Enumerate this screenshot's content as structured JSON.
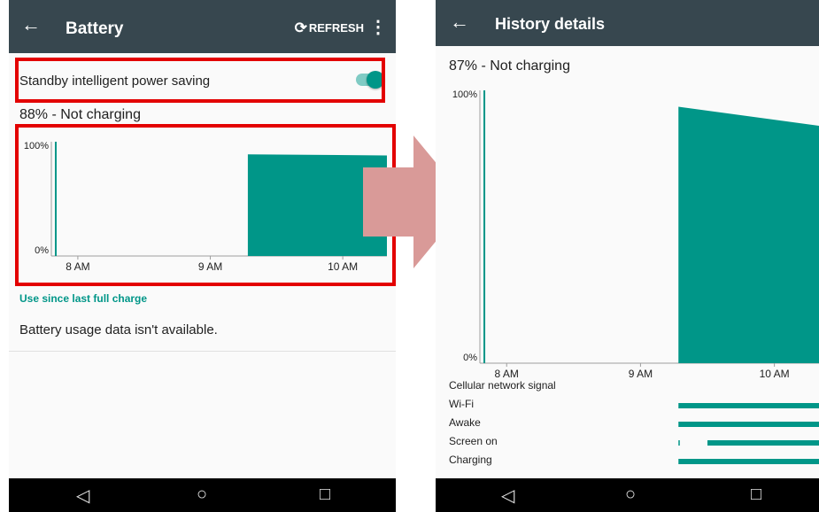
{
  "left": {
    "appbar": {
      "title": "Battery",
      "refresh_label": "REFRESH"
    },
    "standby_saving": {
      "label": "Standby intelligent power saving",
      "enabled": true
    },
    "status": "88% - Not charging",
    "chart_data": {
      "type": "area",
      "title": "",
      "x_ticks": [
        "8 AM",
        "9 AM",
        "10 AM"
      ],
      "y_ticks": [
        "0%",
        "100%"
      ],
      "ylim": [
        0,
        100
      ],
      "x_range": [
        "7:48 AM",
        "10:20 AM"
      ],
      "series": [
        {
          "x": [
            "7:50 AM",
            "7:50 AM"
          ],
          "y": [
            100,
            0
          ]
        },
        {
          "x": [
            "9:17 AM",
            "10:20 AM"
          ],
          "y": [
            89,
            88
          ]
        }
      ]
    },
    "usage_link": "Use since last full charge",
    "usage_message": "Battery usage data isn't available."
  },
  "right": {
    "appbar": {
      "title": "History details"
    },
    "status": "87% - Not charging",
    "chart_data": {
      "type": "area",
      "title": "",
      "x_ticks": [
        "8 AM",
        "9 AM",
        "10 AM"
      ],
      "y_ticks": [
        "0%",
        "100%"
      ],
      "ylim": [
        0,
        100
      ],
      "x_range": [
        "7:48 AM",
        "10:20 AM"
      ],
      "series": [
        {
          "x": [
            "7:50 AM",
            "7:50 AM"
          ],
          "y": [
            100,
            0
          ]
        },
        {
          "x": [
            "9:17 AM",
            "10:20 AM"
          ],
          "y": [
            94,
            87
          ]
        }
      ]
    },
    "signals": {
      "cellular": "Cellular network signal",
      "wifi": "Wi-Fi",
      "awake": "Awake",
      "screen_on": "Screen on",
      "charging": "Charging"
    }
  },
  "navbar": {
    "back": "◁",
    "home": "○",
    "recents": "□"
  },
  "colors": {
    "appbar": "#37474f",
    "accent": "#009688",
    "highlight": "#e30000",
    "arrow": "#d99a98"
  }
}
